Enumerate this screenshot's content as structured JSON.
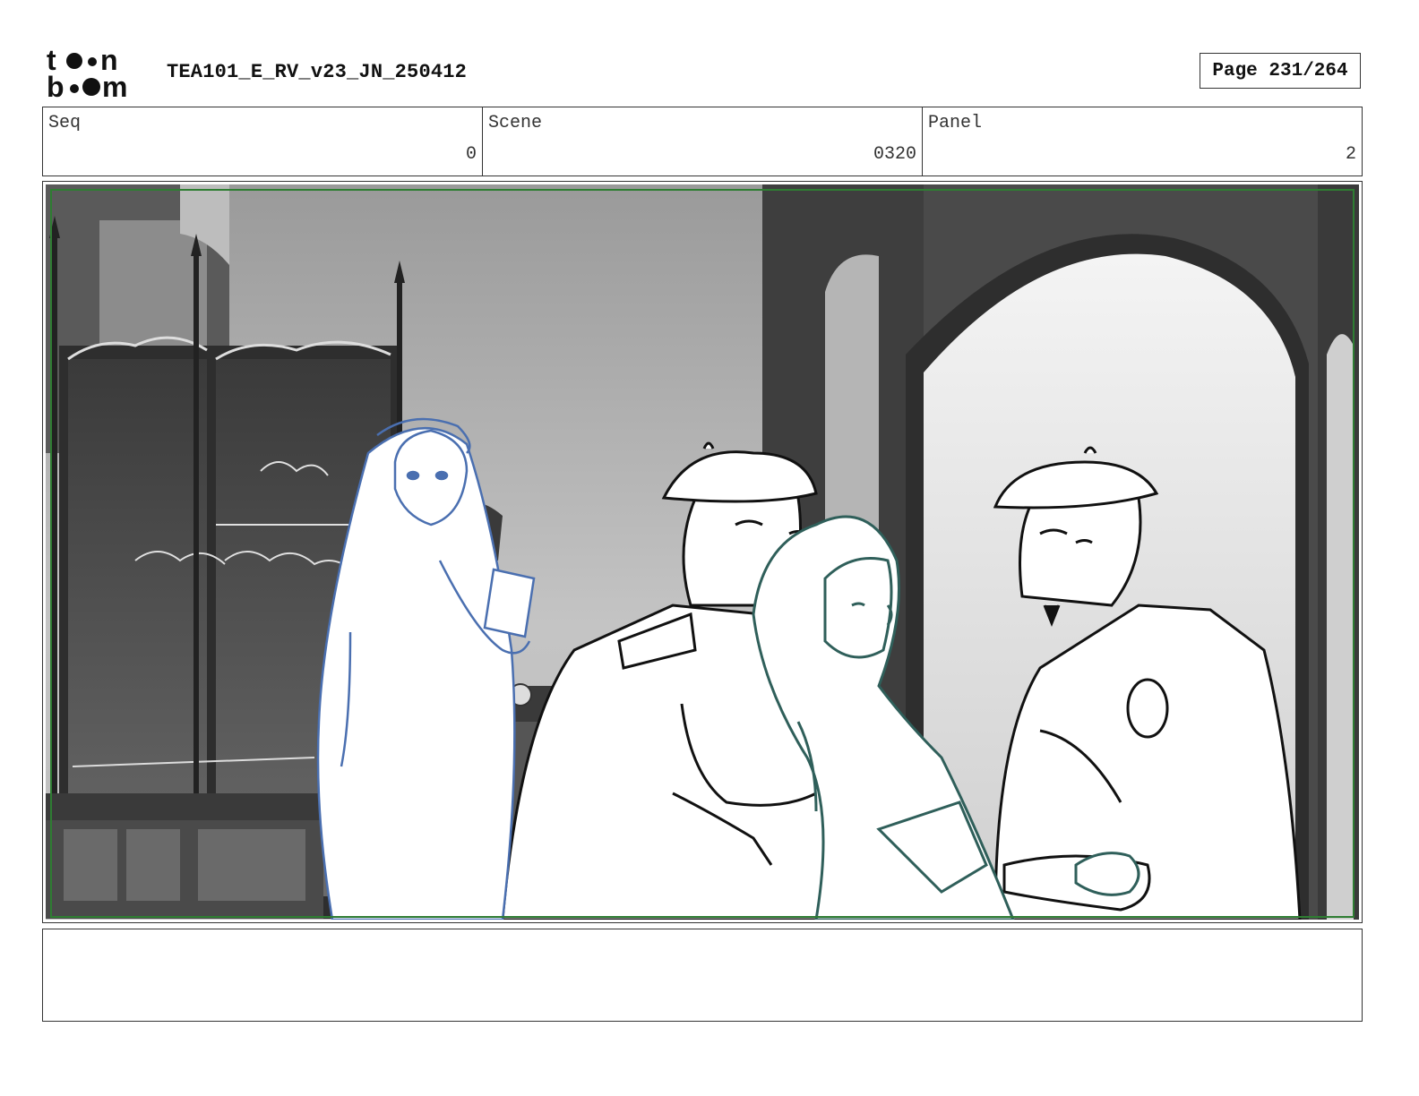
{
  "header": {
    "logo_text": "toon boom",
    "doc_title": "TEA101_E_RV_v23_JN_250412",
    "page_indicator": "Page 231/264"
  },
  "info": {
    "seq": {
      "label": "Seq",
      "value": "0"
    },
    "scene": {
      "label": "Scene",
      "value": "0320"
    },
    "panel": {
      "label": "Panel",
      "value": "2"
    }
  },
  "notes": {
    "text": ""
  },
  "colors": {
    "safe_frame": "#2e7d32",
    "blue_character_line": "#4a6fb0",
    "green_character_line": "#2f5f5a",
    "border": "#333333"
  }
}
